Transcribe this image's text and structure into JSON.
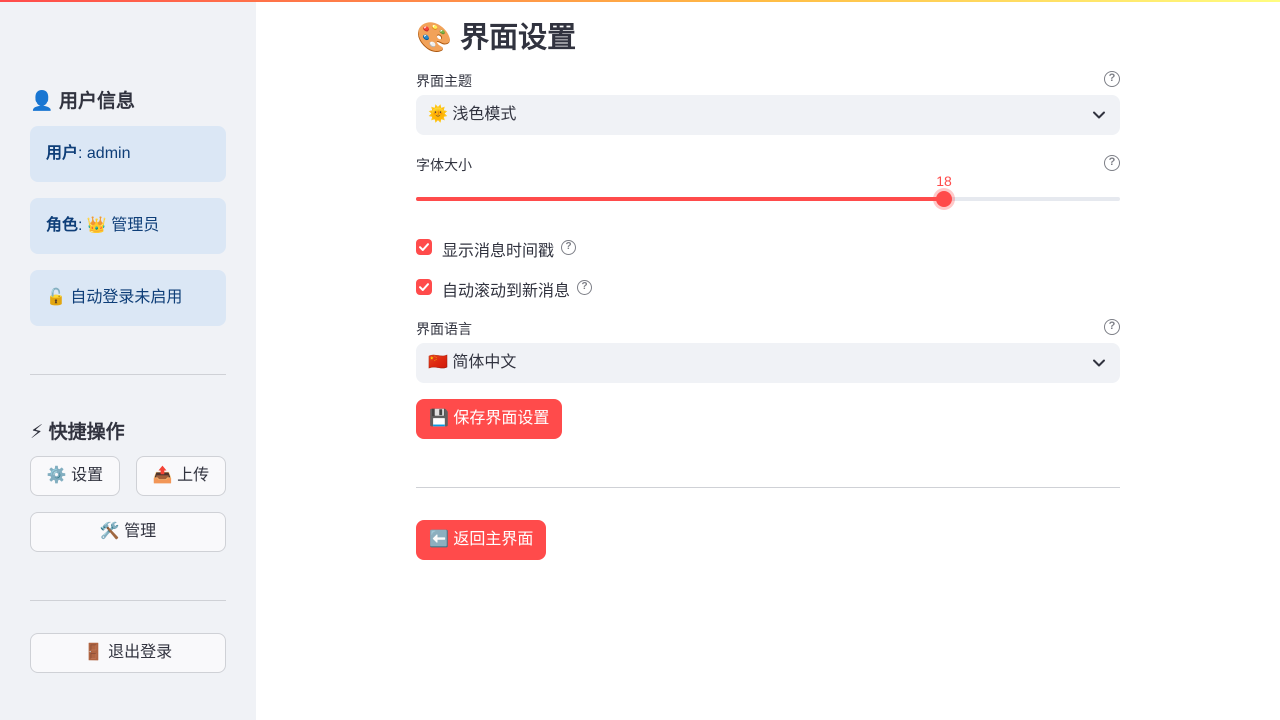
{
  "sidebar": {
    "user_info": {
      "icon": "👤",
      "heading": "用户信息"
    },
    "user_box": {
      "key": "用户",
      "value": ": admin"
    },
    "role_box": {
      "key": "角色",
      "value": ": 👑 管理员"
    },
    "autologin_box": {
      "text": "🔓 自动登录未启用"
    },
    "quick_actions": {
      "icon": "⚡",
      "heading": "快捷操作"
    },
    "settings_button": "⚙️ 设置",
    "upload_button": "📤 上传",
    "manage_button": "🛠️ 管理",
    "logout_button": "🚪 退出登录"
  },
  "main": {
    "title": "🎨 界面设置",
    "theme": {
      "label": "界面主题",
      "value": "🌞 浅色模式"
    },
    "font_size": {
      "label": "字体大小",
      "value": "18",
      "fraction": 0.75
    },
    "show_timestamp": {
      "label": "显示消息时间戳",
      "checked": true
    },
    "auto_scroll": {
      "label": "自动滚动到新消息",
      "checked": true
    },
    "language": {
      "label": "界面语言",
      "value": "🇨🇳 简体中文"
    },
    "save_button": "💾 保存界面设置",
    "back_button": "⬅️ 返回主界面"
  },
  "icons": {
    "help": "question-circle-icon",
    "dropdown": "chevron-down-icon",
    "checkbox": "check-icon"
  },
  "colors": {
    "accent": "#ff4b4b",
    "sidebar_bg": "#f0f2f6",
    "info_bg": "#dbe7f5",
    "info_text": "#0e3e78"
  }
}
